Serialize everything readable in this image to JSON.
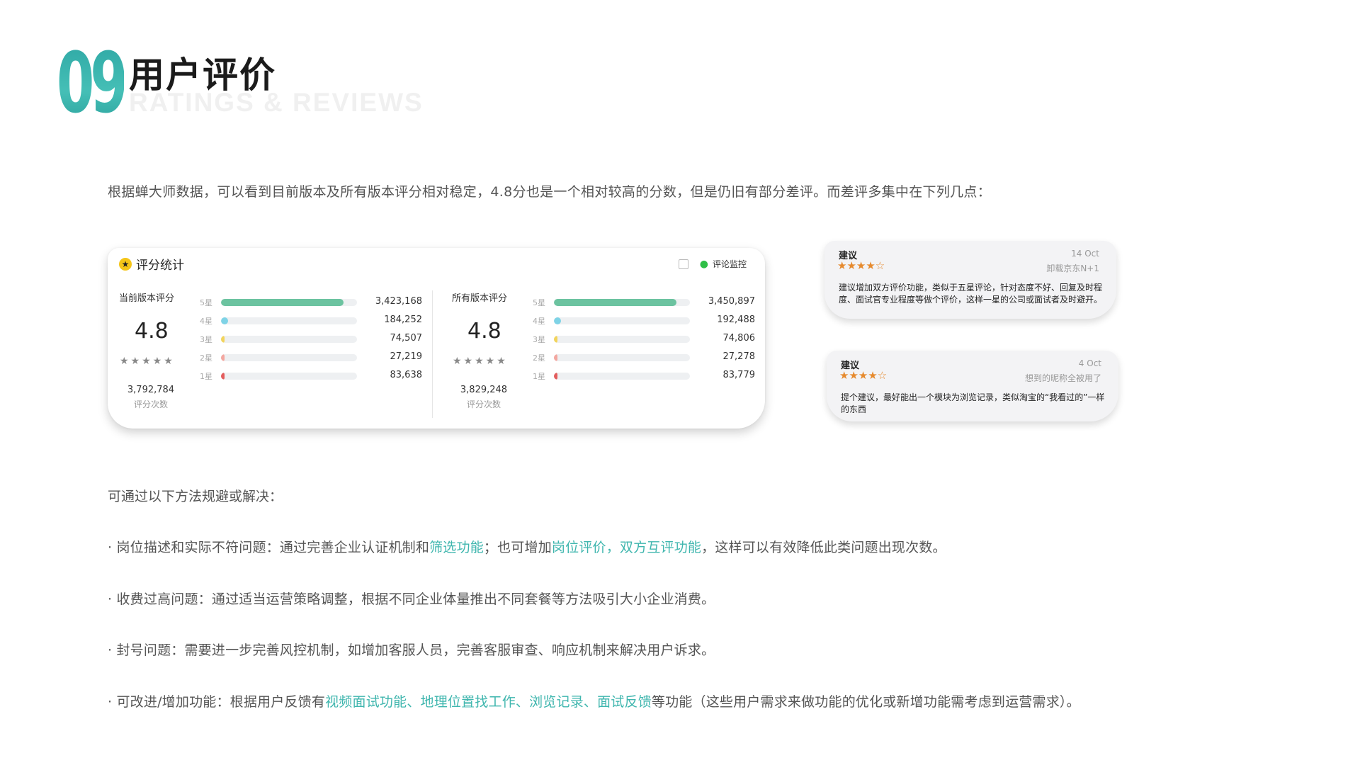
{
  "header": {
    "number": "09",
    "title": "用户评价",
    "subtitle": "RATINGS & REVIEWS"
  },
  "intro": "根据蝉大师数据，可以看到目前版本及所有版本评分相对稳定，4.8分也是一个相对较高的分数，但是仍旧有部分差评。而差评多集中在下列几点：",
  "stats_card": {
    "title": "评分统计",
    "monitor_label": "评论监控",
    "current": {
      "label": "当前版本评分",
      "score": "4.8",
      "stars": "★★★★★",
      "total": "3,792,784",
      "total_label": "评分次数",
      "rows": [
        {
          "label": "5星",
          "value": "3,423,168",
          "fraction": 0.9,
          "color": "#6cc3a0"
        },
        {
          "label": "4星",
          "value": "184,252",
          "fraction": 0.05,
          "color": "#7fd3e6"
        },
        {
          "label": "3星",
          "value": "74,507",
          "fraction": 0.02,
          "color": "#f2d45c"
        },
        {
          "label": "2星",
          "value": "27,219",
          "fraction": 0.01,
          "color": "#f3a7a0"
        },
        {
          "label": "1星",
          "value": "83,638",
          "fraction": 0.025,
          "color": "#e35d5d"
        }
      ]
    },
    "all": {
      "label": "所有版本评分",
      "score": "4.8",
      "stars": "★★★★★",
      "total": "3,829,248",
      "total_label": "评分次数",
      "rows": [
        {
          "label": "5星",
          "value": "3,450,897",
          "fraction": 0.9,
          "color": "#6cc3a0"
        },
        {
          "label": "4星",
          "value": "192,488",
          "fraction": 0.05,
          "color": "#7fd3e6"
        },
        {
          "label": "3星",
          "value": "74,806",
          "fraction": 0.02,
          "color": "#f2d45c"
        },
        {
          "label": "2星",
          "value": "27,278",
          "fraction": 0.01,
          "color": "#f3a7a0"
        },
        {
          "label": "1星",
          "value": "83,779",
          "fraction": 0.025,
          "color": "#e35d5d"
        }
      ]
    }
  },
  "reviews": [
    {
      "title": "建议",
      "date": "14 Oct",
      "stars": "★★★★☆",
      "user": "卸载京东N+1",
      "body": "建议增加双方评价功能，类似于五星评论，针对态度不好、回复及时程度、面试官专业程度等做个评价，这样一星的公司或面试者及时避开。"
    },
    {
      "title": "建议",
      "date": "4 Oct",
      "stars": "★★★★☆",
      "user": "想到的昵称全被用了",
      "body": "提个建议，最好能出一个模块为浏览记录，类似淘宝的“我看过的”一样的东西"
    }
  ],
  "solve_intro": "可通过以下方法规避或解决：",
  "bullets": {
    "b1": {
      "a": "· 岗位描述和实际不符问题：通过完善企业认证机制和",
      "h1": "筛选功能",
      "b": "；也可增加",
      "h2": "岗位评价，双方互评功能",
      "c": "，这样可以有效降低此类问题出现次数。"
    },
    "b2": "· 收费过高问题：通过适当运营策略调整，根据不同企业体量推出不同套餐等方法吸引大小企业消费。",
    "b3": "· 封号问题：需要进一步完善风控机制，如增加客服人员，完善客服审查、响应机制来解决用户诉求。",
    "b4": {
      "a": "· 可改进/增加功能：根据用户反馈有",
      "h1": "视频面试功能、地理位置找工作、浏览记录、面试反馈",
      "b": "等功能（这些用户需求来做功能的优化或新增功能需考虑到运营需求）。"
    }
  },
  "colors": {
    "accent": "#3fb6ae",
    "star_orange": "#e68a2e"
  }
}
